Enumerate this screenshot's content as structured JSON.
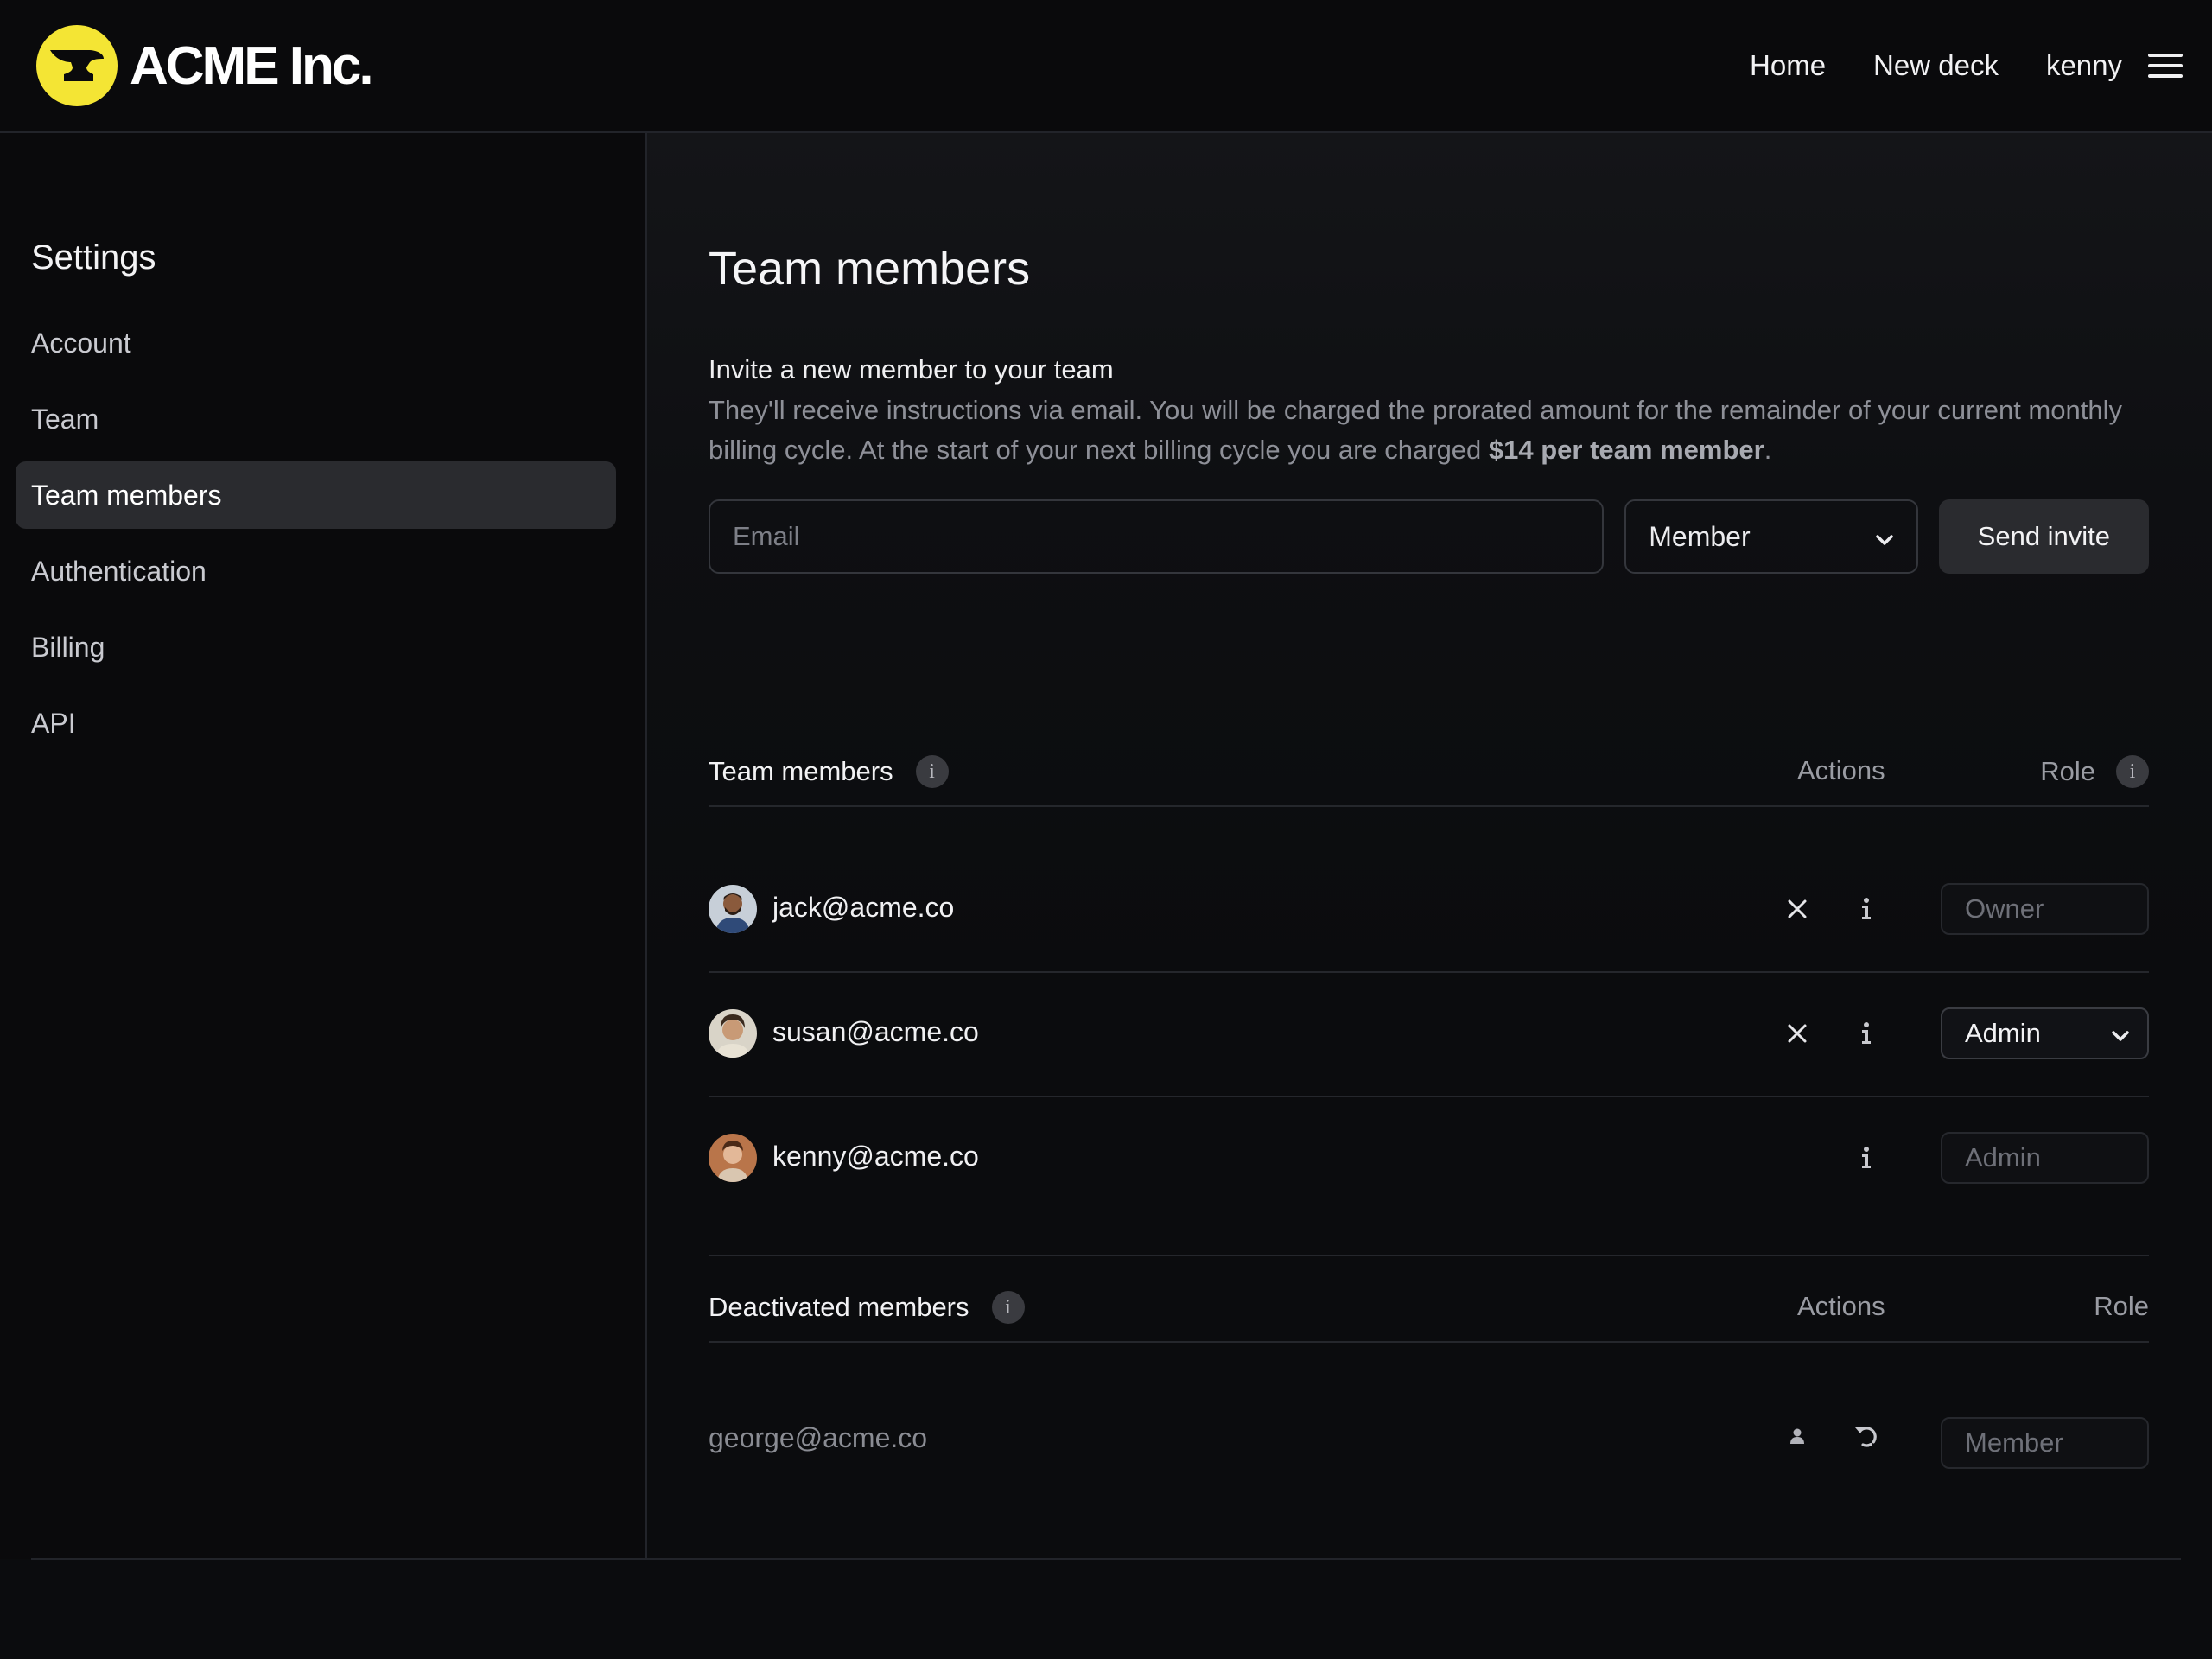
{
  "app": {
    "brand": "ACME Inc."
  },
  "topnav": {
    "home": "Home",
    "new_deck": "New deck",
    "user": "kenny"
  },
  "sidebar": {
    "title": "Settings",
    "items": [
      {
        "label": "Account"
      },
      {
        "label": "Team"
      },
      {
        "label": "Team members",
        "active": true
      },
      {
        "label": "Authentication"
      },
      {
        "label": "Billing"
      },
      {
        "label": "API"
      }
    ]
  },
  "page": {
    "title": "Team members",
    "invite": {
      "heading": "Invite a new member to your team",
      "description": "They'll receive instructions via email. You will be charged the prorated amount for the remainder of your current monthly billing cycle. At the start of your next billing cycle you are charged ",
      "price_highlight": "$14 per team member",
      "description_end": ".",
      "email_placeholder": "Email",
      "role_value": "Member",
      "send_label": "Send invite"
    },
    "members_section": {
      "label": "Team members",
      "actions_header": "Actions",
      "role_header": "Role",
      "rows": [
        {
          "email": "jack@acme.co",
          "role": "Owner",
          "role_editable": false,
          "can_remove": true
        },
        {
          "email": "susan@acme.co",
          "role": "Admin",
          "role_editable": true,
          "can_remove": true
        },
        {
          "email": "kenny@acme.co",
          "role": "Admin",
          "role_editable": false,
          "can_remove": false
        }
      ]
    },
    "deactivated_section": {
      "label": "Deactivated members",
      "actions_header": "Actions",
      "role_header": "Role",
      "rows": [
        {
          "email": "george@acme.co",
          "role": "Member"
        }
      ]
    }
  },
  "icons": {
    "menu": "hamburger-icon",
    "chevron": "chevron-down-icon",
    "remove": "close-icon",
    "info": "info-icon",
    "reactivate_user": "user-icon",
    "restore": "undo-icon"
  },
  "colors": {
    "brand_yellow": "#f4e534",
    "background": "#0b0c0e",
    "active_item_bg": "#2a2b2f"
  }
}
